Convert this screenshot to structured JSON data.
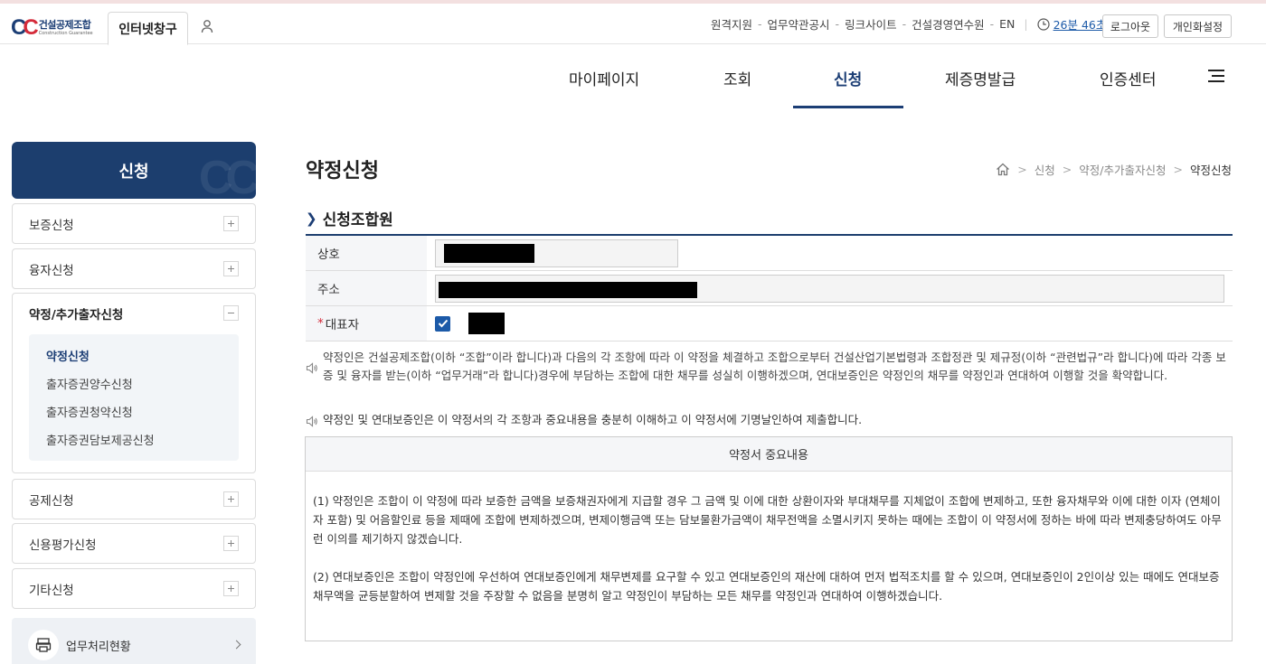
{
  "header": {
    "logo": {
      "korean": "건설공제조합",
      "english": "Construction Guarantee"
    },
    "window_tab": "인터넷창구",
    "util_links": [
      "원격지원",
      "업무약관공시",
      "링크사이트",
      "건설경영연수원",
      "EN"
    ],
    "session_timer": "26분 46초",
    "logout_label": "로그아웃",
    "personalize_label": "개인화설정"
  },
  "gnb": {
    "items": [
      "마이페이지",
      "조회",
      "신청",
      "제증명발급",
      "인증센터"
    ],
    "active": "신청"
  },
  "sidebar": {
    "title": "신청",
    "menus": [
      {
        "label": "보증신청",
        "expanded": false
      },
      {
        "label": "융자신청",
        "expanded": false
      },
      {
        "label": "약정/추가출자신청",
        "expanded": true
      },
      {
        "label": "공제신청",
        "expanded": false
      },
      {
        "label": "신용평가신청",
        "expanded": false
      },
      {
        "label": "기타신청",
        "expanded": false
      }
    ],
    "submenu": [
      "약정신청",
      "출자증권양수신청",
      "출자증권청약신청",
      "출자증권담보제공신청"
    ],
    "status_link": "업무처리현황"
  },
  "page": {
    "title": "약정신청",
    "breadcrumb": [
      "신청",
      "약정/추가출자신청",
      "약정신청"
    ],
    "section_title": "신청조합원",
    "fields": {
      "name_label": "상호",
      "address_label": "주소",
      "rep_label": "대표자",
      "rep_required_mark": "*"
    },
    "notice1": "약정인은 건설공제조합(이하 “조합”이라 합니다)과 다음의 각 조항에 따라 이 약정을 체결하고 조합으로부터 건설산업기본법령과 조합정관 및 제규정(이하 “관련법규”라 합니다)에 따라 각종 보증 및 융자를 받는(이하 “업무거래”라 합니다)경우에 부담하는 조합에 대한 채무를 성실히 이행하겠으며, 연대보증인은 약정인의 채무를 약정인과 연대하여 이행할 것을 확약합니다.",
    "notice2": "약정인 및 연대보증인은 이 약정서의 각 조항과 중요내용을 충분히 이해하고 이 약정서에 기명날인하여 제출합니다.",
    "terms_title": "약정서 중요내용",
    "terms": [
      "(1) 약정인은 조합이 이 약정에 따라 보증한 금액을 보증채권자에게 지급할 경우 그 금액 및 이에 대한 상환이자와 부대채무를 지체없이 조합에 변제하고, 또한 융자채무와 이에 대한 이자 (연체이자 포함) 및 어음할인료 등을 제때에 조합에 변제하겠으며, 변제이행금액 또는 담보물환가금액이 채무전액을 소멸시키지 못하는 때에는 조합이 이 약정서에 정하는 바에 따라 변제충당하여도 아무런 이의를 제기하지 않겠습니다.",
      "(2) 연대보증인은 조합이 약정인에 우선하여 연대보증인에게 채무변제를 요구할 수 있고 연대보증인의 재산에 대하여 먼저 법적조치를 할 수 있으며, 연대보증인이 2인이상 있는 때에도 연대보증채무액을 균등분할하여 변제할 것을 주장할 수 없음을 분명히 알고 약정인이 부담하는 모든 채무를 약정인과 연대하여 이행하겠습니다."
    ]
  },
  "colors": {
    "primary": "#1c3e6e",
    "accent_red": "#d42b3a",
    "link_blue": "#1c5aa8"
  }
}
